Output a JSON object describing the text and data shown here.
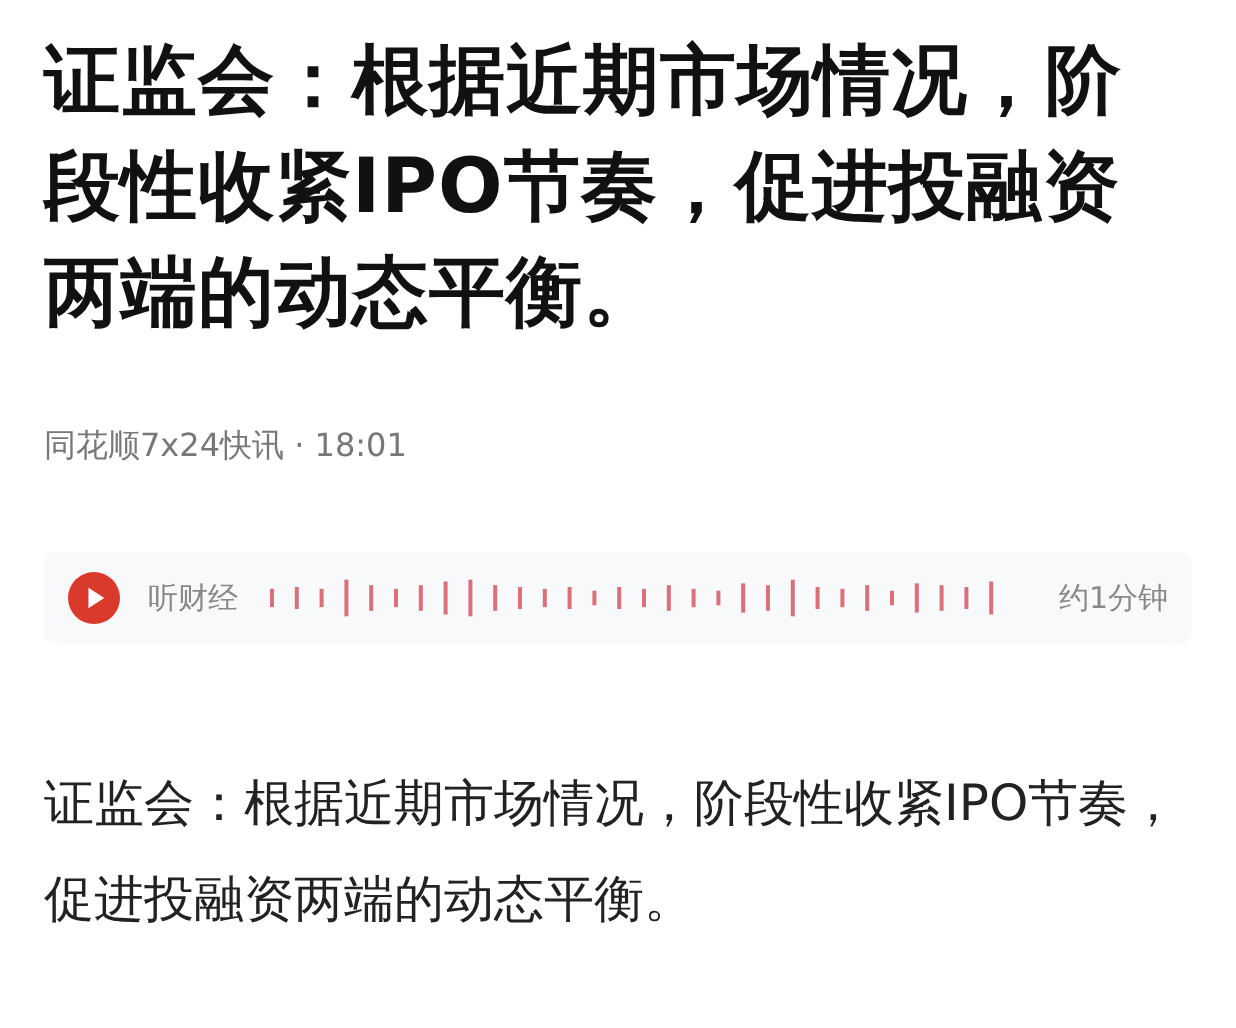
{
  "headline": "证监会：根据近期市场情况，阶段性收紧IPO节奏，促进投融资两端的动态平衡。",
  "source": "同花顺7x24快讯 · 18:01",
  "audio": {
    "label": "听财经",
    "duration": "约1分钟"
  },
  "body": "证监会：根据近期市场情况，阶段性收紧IPO节奏，促进投融资两端的动态平衡。"
}
